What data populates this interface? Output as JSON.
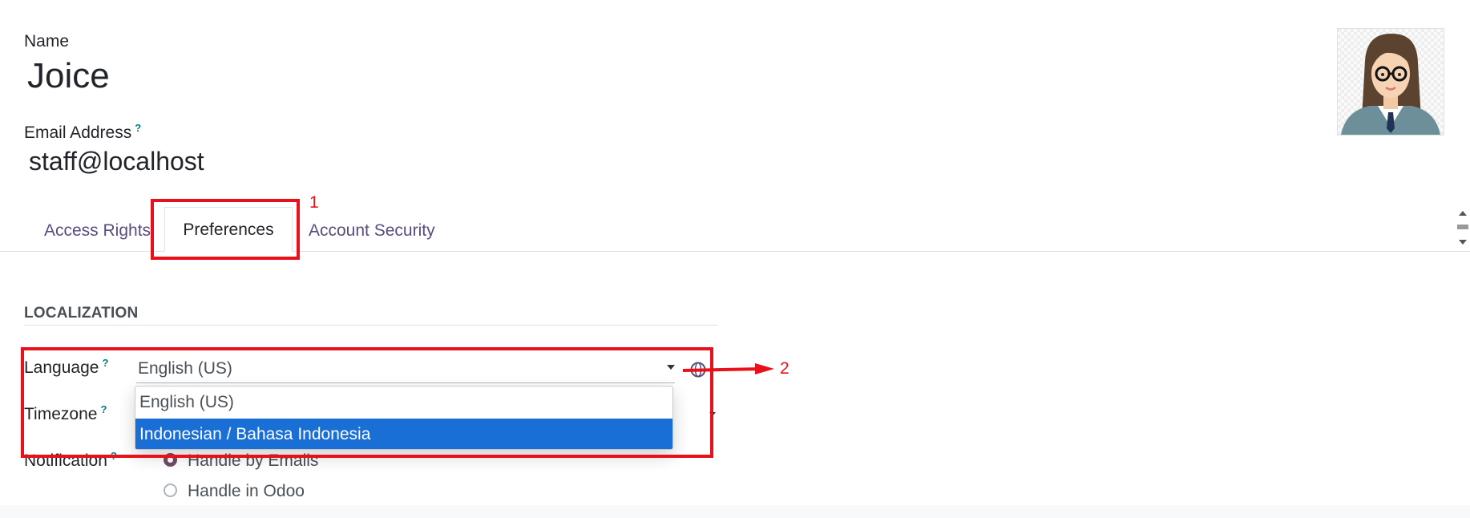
{
  "form": {
    "name_label": "Name",
    "name_value": "Joice",
    "email_label": "Email Address",
    "email_help": "?",
    "email_value": "staff@localhost"
  },
  "tabs": [
    {
      "label": "Access Rights",
      "active": false
    },
    {
      "label": "Preferences",
      "active": true
    },
    {
      "label": "Account Security",
      "active": false
    }
  ],
  "localization": {
    "section_title": "LOCALIZATION",
    "language_label": "Language",
    "language_help": "?",
    "language_value": "English (US)",
    "timezone_label": "Timezone",
    "timezone_help": "?",
    "notification_label": "Notification",
    "notification_help": "?",
    "notification_options": [
      {
        "label": "Handle by Emails",
        "checked": true
      },
      {
        "label": "Handle in Odoo",
        "checked": false
      }
    ]
  },
  "language_dropdown": {
    "options": [
      {
        "label": "English (US)",
        "highlighted": false
      },
      {
        "label": "Indonesian / Bahasa Indonesia",
        "highlighted": true
      }
    ]
  },
  "annotations": {
    "step1": "1",
    "step2": "2"
  },
  "colors": {
    "accent": "#714b67",
    "annotation_red": "#e8111a",
    "highlight_blue": "#1a6fd6",
    "tab_link": "#5a4c7d"
  },
  "icons": {
    "avatar": "female-avatar-glasses",
    "globe": "globe-icon",
    "caret": "caret-down-icon"
  }
}
